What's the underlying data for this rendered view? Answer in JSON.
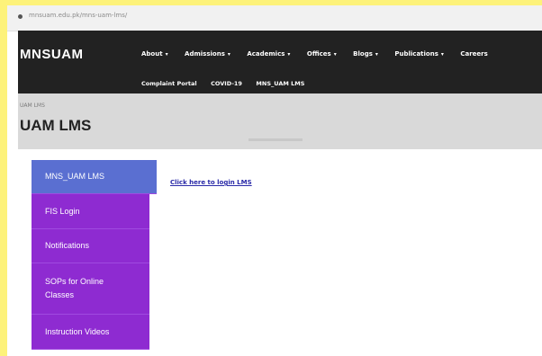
{
  "browser": {
    "url": "mnsuam.edu.pk/mns-uam-lms/"
  },
  "site": {
    "logo": "MNSUAM"
  },
  "nav": {
    "menu": [
      {
        "label": "About",
        "has_caret": true
      },
      {
        "label": "Admissions",
        "has_caret": true
      },
      {
        "label": "Academics",
        "has_caret": true
      },
      {
        "label": "Offices",
        "has_caret": true
      },
      {
        "label": "Blogs",
        "has_caret": true
      },
      {
        "label": "Publications",
        "has_caret": true
      },
      {
        "label": "Careers",
        "has_caret": false
      }
    ],
    "submenu": [
      {
        "label": "Complaint Portal"
      },
      {
        "label": "COVID-19"
      },
      {
        "label": "MNS_UAM LMS"
      }
    ]
  },
  "banner": {
    "breadcrumb": "UAM LMS",
    "title": "UAM LMS"
  },
  "sidebar": {
    "items": [
      {
        "label": "MNS_UAM LMS"
      },
      {
        "label": "FIS Login"
      },
      {
        "label": "Notifications"
      },
      {
        "label": "SOPs for Online Classes"
      },
      {
        "label": "Instruction Videos"
      }
    ]
  },
  "main": {
    "link_text": "Click here to login LMS"
  },
  "colors": {
    "nav_bg": "#222222",
    "sidebar_bg": "#8e2bd1",
    "sidebar_active_bg": "#5a6fd1",
    "banner_bg": "#d9d9d9",
    "link": "#2a2aa8"
  }
}
